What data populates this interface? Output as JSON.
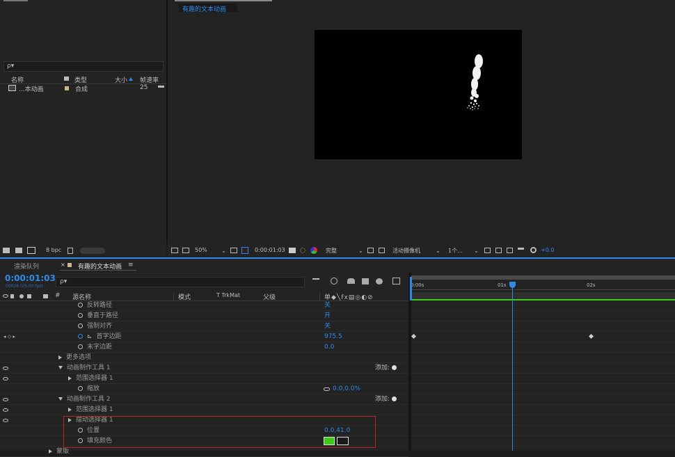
{
  "project": {
    "search_placeholder": "ρ▾",
    "columns": {
      "name": "名称",
      "type": "类型",
      "size": "大小",
      "fps": "帧速率"
    },
    "items": [
      {
        "name": "...本动画",
        "type": "合成",
        "fps": "25"
      }
    ],
    "bpc": "8 bpc"
  },
  "viewer": {
    "tab_label": "有趣的文本动画",
    "zoom": "50%",
    "timecode": "0:00:01:03",
    "resolution": "完整",
    "camera": "活动摄像机",
    "views": "1个...",
    "exposure": "+0.0"
  },
  "timeline": {
    "tabs": [
      "渲染队列",
      "有趣的文本动画"
    ],
    "current_time": "0:00:01:03",
    "frame_info": "00028 (25.00 fps)",
    "search_placeholder": "ρ▾",
    "columns": {
      "source": "源名称",
      "mode": "模式",
      "trkmat": "T  TrkMat",
      "parent": "父级"
    },
    "ruler_ticks": [
      "0:00s",
      "01s",
      "02s"
    ],
    "rows": [
      {
        "label": "反转路径",
        "value": "关"
      },
      {
        "label": "垂直于路径",
        "value": "开"
      },
      {
        "label": "强制对齐",
        "value": "关"
      },
      {
        "label": "首字边距",
        "value": "975.5"
      },
      {
        "label": "末字边距",
        "value": "0.0"
      },
      {
        "label": "更多选项"
      },
      {
        "label": "动画制作工具 1",
        "add": "添加:"
      },
      {
        "label": "范围选择器 1"
      },
      {
        "label": "缩放",
        "value": "0.0,0.0%"
      },
      {
        "label": "动画制作工具 2",
        "add": "添加:"
      },
      {
        "label": "范围选择器 1"
      },
      {
        "label": "摆动选择器 1"
      },
      {
        "label": "位置",
        "value": "0.0,41.0"
      },
      {
        "label": "填充颜色"
      },
      {
        "label": "蒙版"
      }
    ],
    "fill_color": "#3ecb17",
    "accent": "#2d8ceb",
    "highlight_box": "#b3262b"
  }
}
